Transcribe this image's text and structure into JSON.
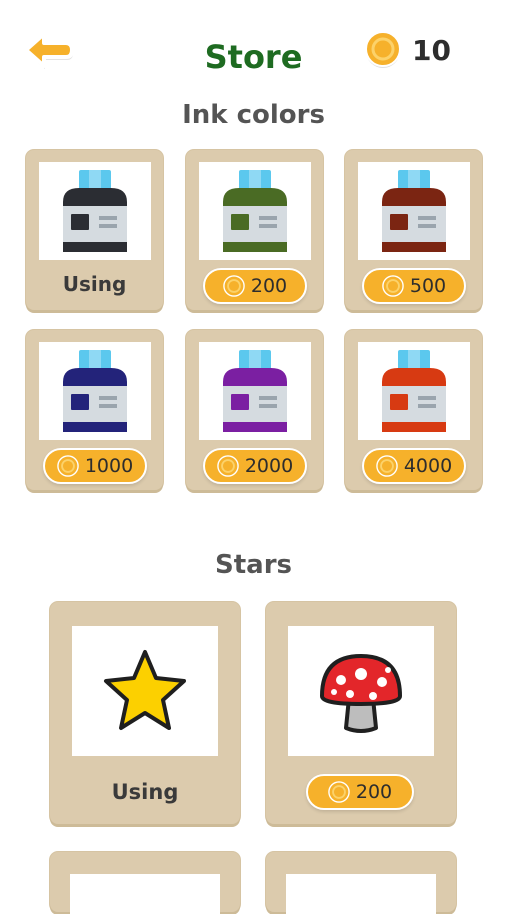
{
  "header": {
    "title": "Store",
    "coins": "10"
  },
  "sections": {
    "ink": {
      "title": "Ink colors",
      "items": [
        {
          "color": "#2b2d33",
          "status": "Using",
          "price": ""
        },
        {
          "color": "#4a6b24",
          "status": "",
          "price": "200"
        },
        {
          "color": "#7b2512",
          "status": "",
          "price": "500"
        },
        {
          "color": "#23237a",
          "status": "",
          "price": "1000"
        },
        {
          "color": "#7b1fa2",
          "status": "",
          "price": "2000"
        },
        {
          "color": "#d73a12",
          "status": "",
          "price": "4000"
        }
      ]
    },
    "stars": {
      "title": "Stars",
      "items": [
        {
          "icon": "star-icon",
          "status": "Using",
          "price": ""
        },
        {
          "icon": "mushroom-icon",
          "status": "",
          "price": "200"
        }
      ]
    }
  },
  "colors": {
    "title": "#1e6b21",
    "card": "#dccbad",
    "coin": "#f6b12b",
    "cap": "#5bc8ee"
  }
}
